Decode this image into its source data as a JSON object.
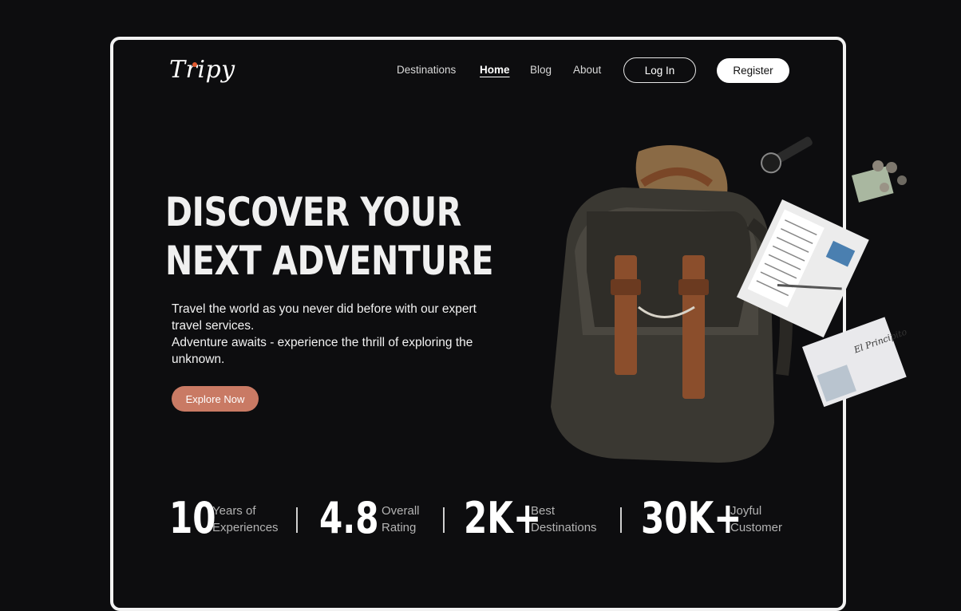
{
  "brand": {
    "logo_text": "Tripy"
  },
  "nav": {
    "items": [
      {
        "label": "Destinations",
        "active": false
      },
      {
        "label": "Home",
        "active": true
      },
      {
        "label": "Blog",
        "active": false
      },
      {
        "label": "About",
        "active": false
      }
    ],
    "login_label": "Log In",
    "register_label": "Register"
  },
  "hero": {
    "title_line1": "DISCOVER YOUR",
    "title_line2": "NEXT ADVENTURE",
    "paragraph1": "Travel the world as you never did before with our expert travel services.",
    "paragraph2": "Adventure awaits - experience the thrill of exploring the unknown.",
    "cta_label": "Explore Now",
    "book_cover_text": "El Principito"
  },
  "stats": [
    {
      "value": "10",
      "label_line1": "Years of",
      "label_line2": "Experiences"
    },
    {
      "value": "4.8",
      "label_line1": "Overall",
      "label_line2": "Rating"
    },
    {
      "value": "2K+",
      "label_line1": "Best",
      "label_line2": "Destinations"
    },
    {
      "value": "30K+",
      "label_line1": "Joyful",
      "label_line2": "Customer"
    }
  ],
  "colors": {
    "background": "#0d0d0f",
    "accent": "#c97a64",
    "logo_dot": "#e1592f",
    "frame_border": "#f2f2f2"
  }
}
